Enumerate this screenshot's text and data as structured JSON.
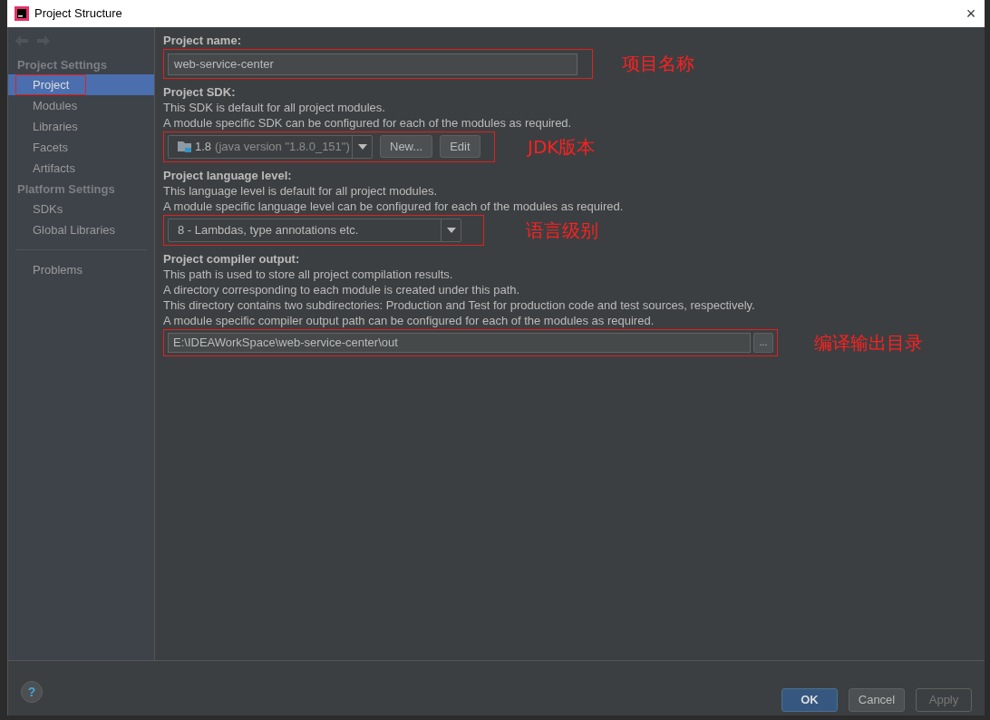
{
  "window": {
    "title": "Project Structure",
    "close": "×"
  },
  "sidebar": {
    "groups": [
      {
        "heading": "Project Settings",
        "items": [
          {
            "label": "Project",
            "selected": true,
            "highlighted": true
          },
          {
            "label": "Modules",
            "selected": false,
            "highlighted": false
          },
          {
            "label": "Libraries",
            "selected": false,
            "highlighted": false
          },
          {
            "label": "Facets",
            "selected": false,
            "highlighted": false
          },
          {
            "label": "Artifacts",
            "selected": false,
            "highlighted": false
          }
        ]
      },
      {
        "heading": "Platform Settings",
        "items": [
          {
            "label": "SDKs",
            "selected": false,
            "highlighted": false
          },
          {
            "label": "Global Libraries",
            "selected": false,
            "highlighted": false
          }
        ]
      }
    ],
    "extra_items": [
      {
        "label": "Problems",
        "selected": false,
        "highlighted": false
      }
    ]
  },
  "sections": [
    {
      "kind": "text",
      "label": "Project name:",
      "value": "web-service-center",
      "annotation": "项目名称"
    },
    {
      "kind": "sdk",
      "label": "Project SDK:",
      "descriptions": [
        "This SDK is default for all project modules.",
        "A module specific SDK can be configured for each of the modules as required."
      ],
      "version": "1.8",
      "detail": "(java version \"1.8.0_151\")",
      "buttons": [
        "New...",
        "Edit"
      ],
      "annotation": "JDK版本"
    },
    {
      "kind": "select",
      "label": "Project language level:",
      "descriptions": [
        "This language level is default for all project modules.",
        "A module specific language level can be configured for each of the modules as required."
      ],
      "selected_option": "8 - Lambdas, type annotations etc.",
      "annotation": "语言级别"
    },
    {
      "kind": "path",
      "label": "Project compiler output:",
      "descriptions": [
        "This path is used to store all project compilation results.",
        "A directory corresponding to each module is created under this path.",
        "This directory contains two subdirectories: Production and Test for production code and test sources, respectively.",
        "A module specific compiler output path can be configured for each of the modules as required."
      ],
      "value": "E:\\IDEAWorkSpace\\web-service-center\\out",
      "browse": "...",
      "annotation": "编译输出目录"
    }
  ],
  "footer": {
    "help": "?",
    "buttons": [
      {
        "label": "OK",
        "kind": "default",
        "disabled": false
      },
      {
        "label": "Cancel",
        "kind": "normal",
        "disabled": false
      },
      {
        "label": "Apply",
        "kind": "normal",
        "disabled": true
      }
    ]
  }
}
